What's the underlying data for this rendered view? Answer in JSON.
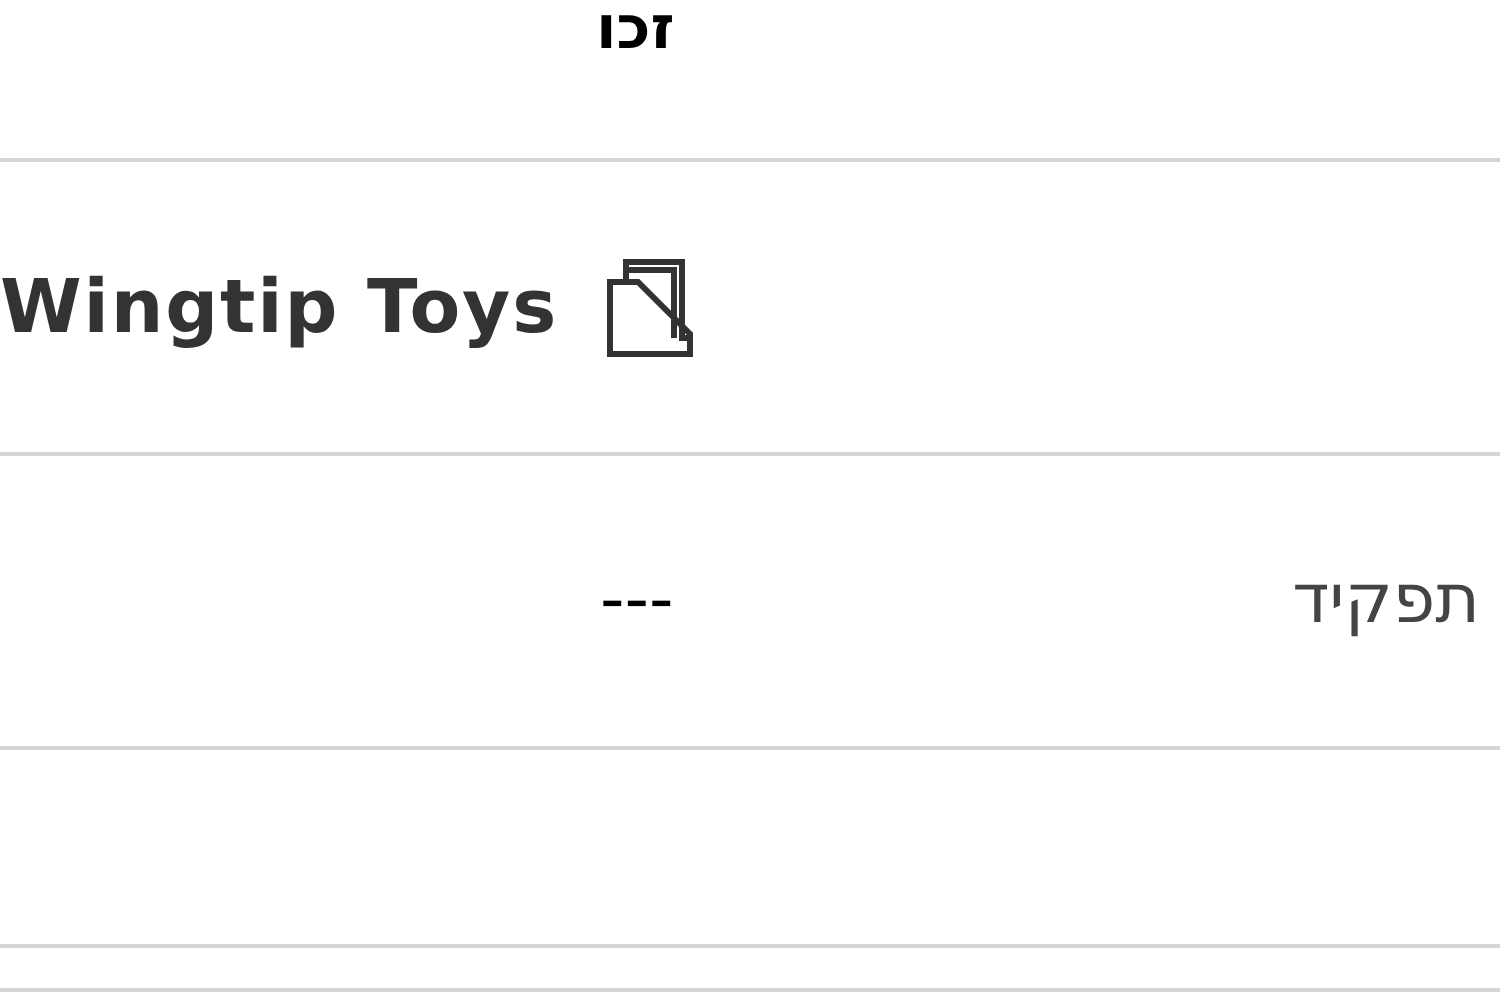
{
  "header": {
    "title": "זכו"
  },
  "fields": [
    {
      "kind": "account",
      "value": "Wingtip Toys"
    },
    {
      "kind": "text",
      "label": "תפקיד",
      "value": "---"
    }
  ]
}
